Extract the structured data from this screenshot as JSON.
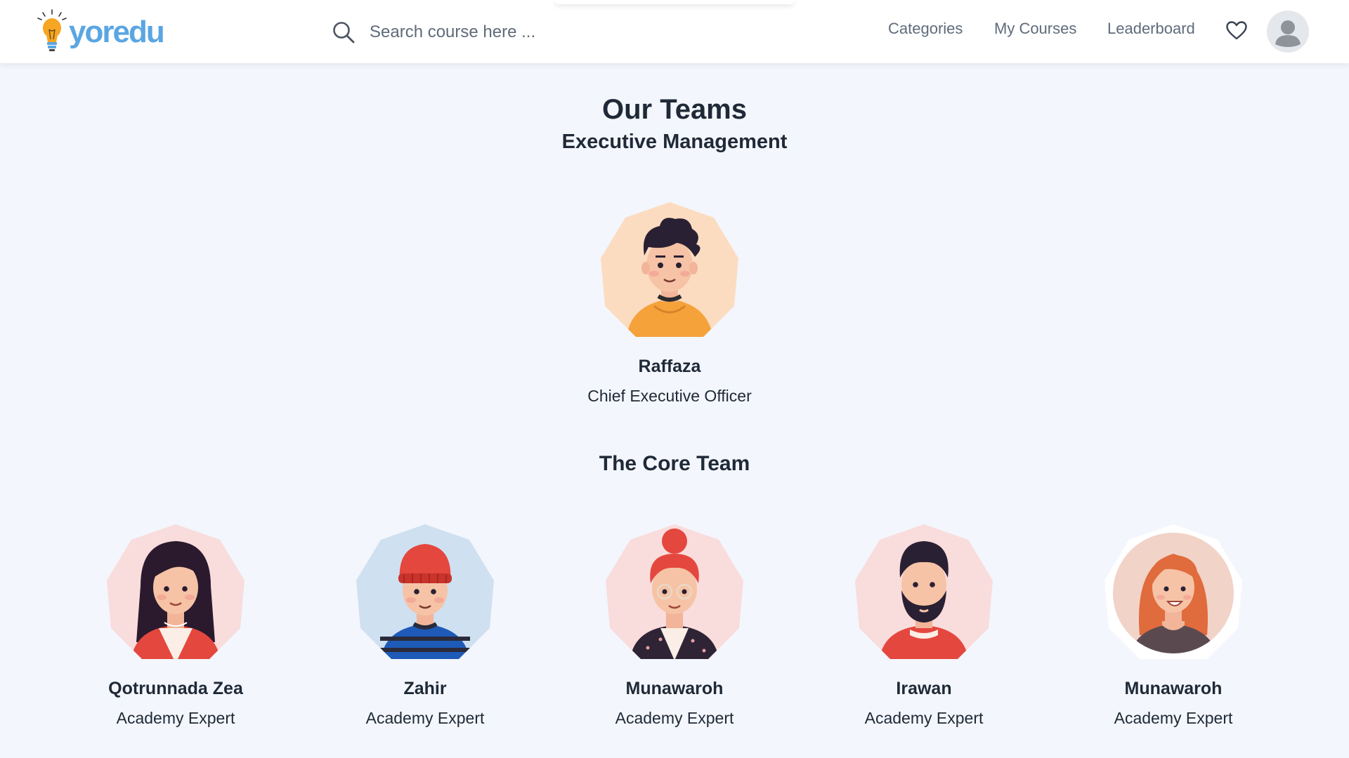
{
  "header": {
    "logo_text": "yoredu",
    "search_placeholder": "Search course here ...",
    "nav": {
      "categories": "Categories",
      "my_courses": "My Courses",
      "leaderboard": "Leaderboard"
    },
    "icons": [
      "search-icon",
      "heart-icon",
      "user-avatar-icon"
    ]
  },
  "main": {
    "title": "Our Teams",
    "subtitle": "Executive Management",
    "ceo": {
      "name": "Raffaza",
      "role": "Chief Executive Officer"
    },
    "core_title": "The Core Team",
    "core_team": [
      {
        "name": "Qotrunnada Zea",
        "role": "Academy Expert"
      },
      {
        "name": "Zahir",
        "role": "Academy Expert"
      },
      {
        "name": "Munawaroh",
        "role": "Academy Expert"
      },
      {
        "name": "Irawan",
        "role": "Academy Expert"
      },
      {
        "name": "Munawaroh",
        "role": "Academy Expert"
      }
    ]
  },
  "colors": {
    "background": "#f3f6fc",
    "brand": "#5aa6e2",
    "text": "#1f2937",
    "nav_text": "#5f6b7a"
  }
}
